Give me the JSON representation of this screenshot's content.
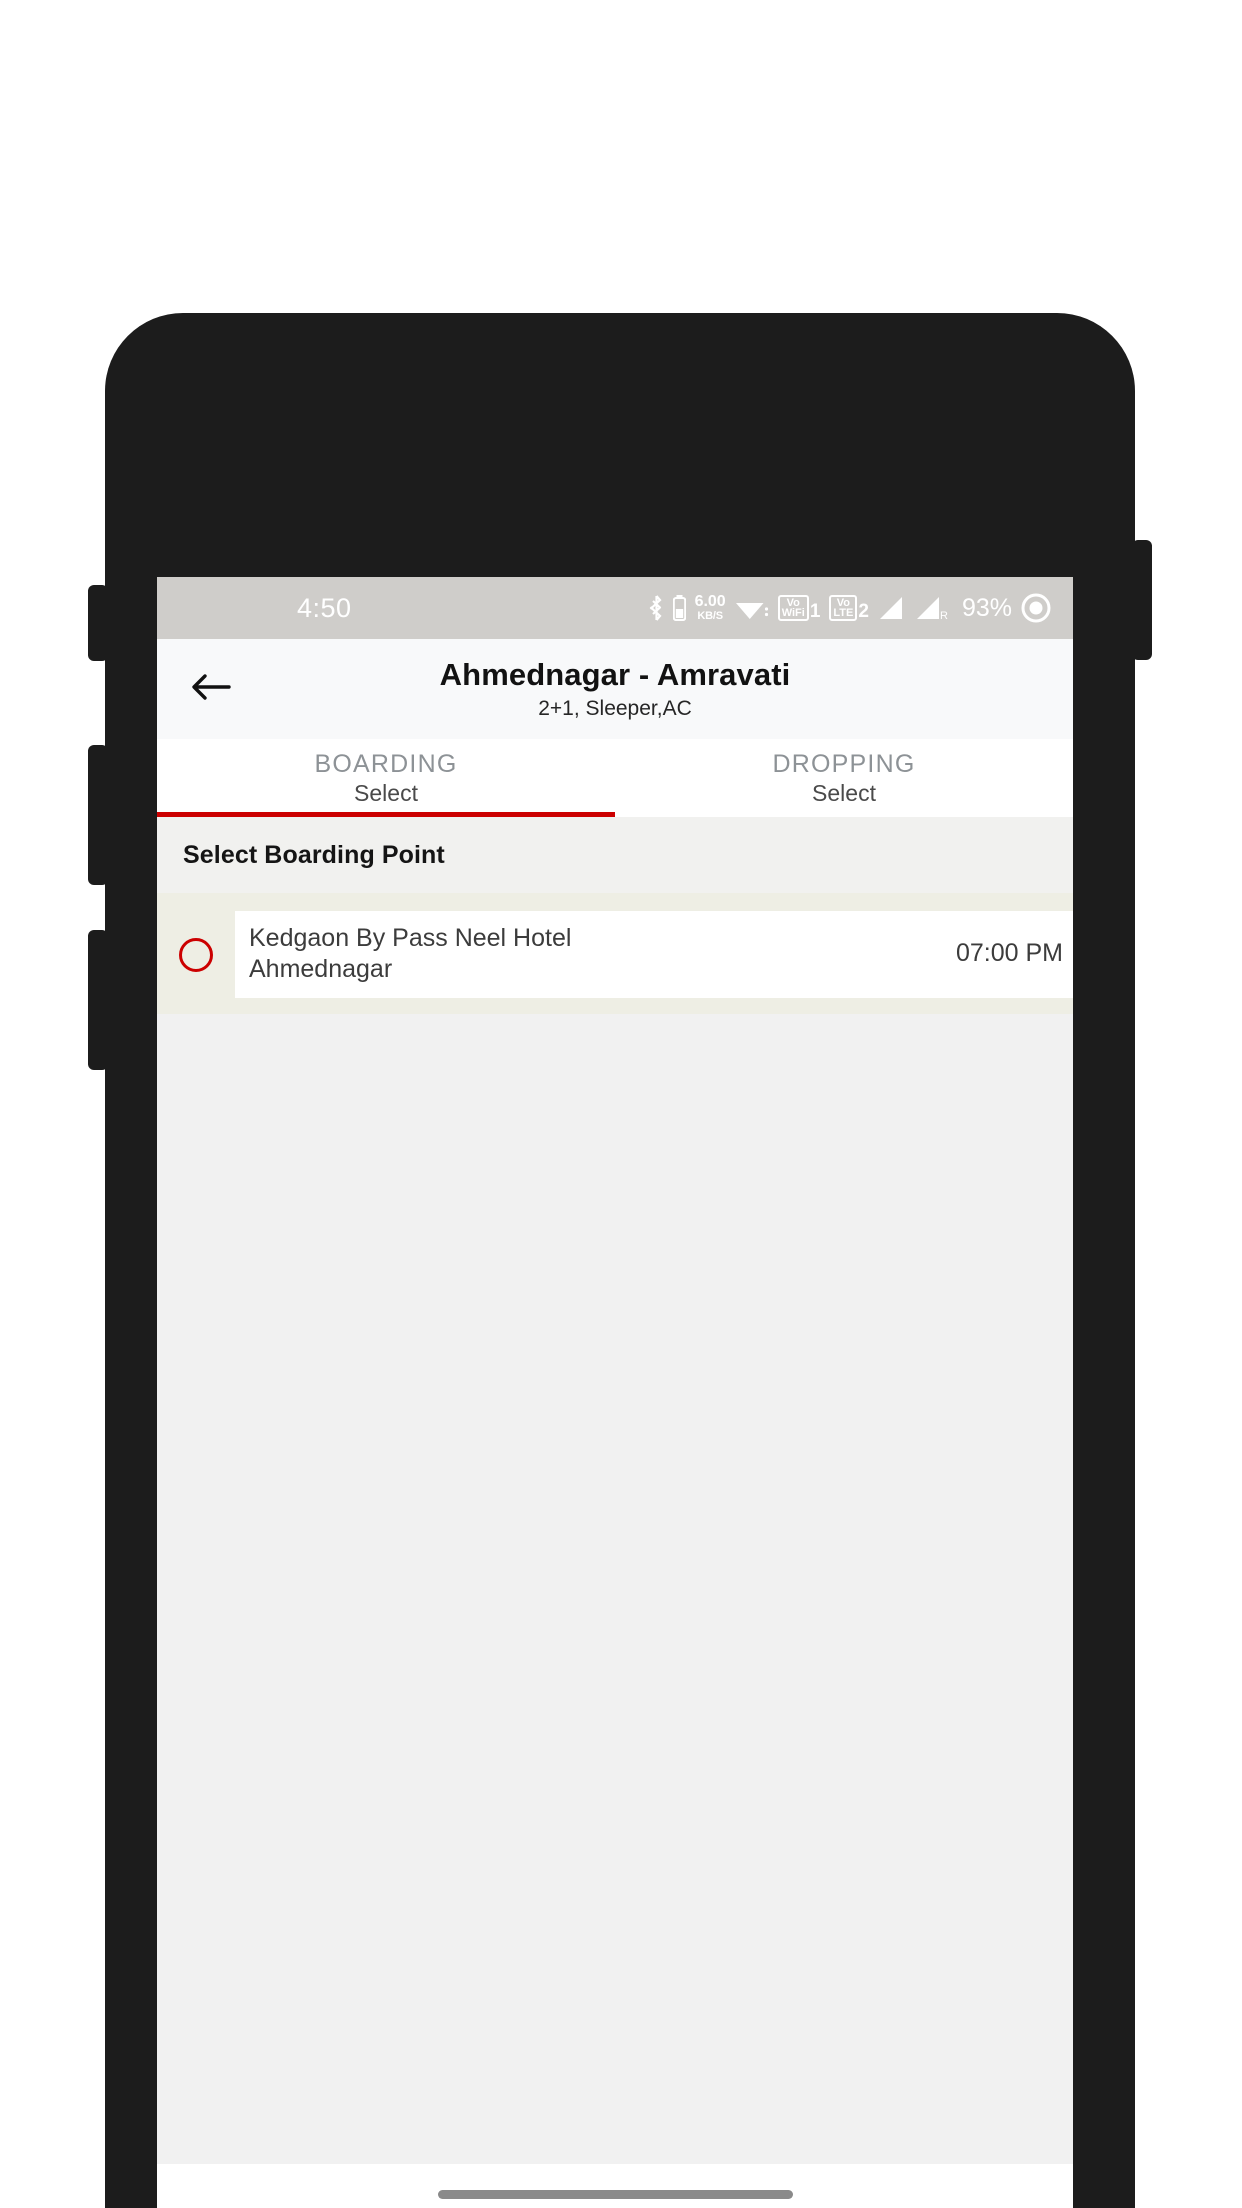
{
  "status_bar": {
    "clock": "4:50",
    "data_rate_value": "6.00",
    "data_rate_unit": "KB/S",
    "vowifi_label_top": "Vo",
    "vowifi_label_bottom": "WiFi",
    "vowifi_sim": "1",
    "volte_label_top": "Vo",
    "volte_label_bottom": "LTE",
    "volte_sim": "2",
    "roaming_marker": "R",
    "battery_percent": "93%",
    "icons": [
      "bluetooth-icon",
      "bluetooth-battery-icon",
      "data-rate-indicator",
      "wifi-icon",
      "vowifi-badge-icon",
      "volte-badge-icon",
      "signal-bars-sim1-icon",
      "signal-bars-sim2-icon",
      "battery-ring-icon"
    ]
  },
  "app_bar": {
    "back_icon": "arrow-left-icon",
    "title": "Ahmednagar - Amravati",
    "subtitle": "2+1, Sleeper,AC"
  },
  "tabs": [
    {
      "label": "BOARDING",
      "value": "Select",
      "active": true
    },
    {
      "label": "DROPPING",
      "value": "Select",
      "active": false
    }
  ],
  "section": {
    "header": "Select Boarding Point"
  },
  "boarding_points": [
    {
      "name": "Kedgaon By Pass Neel Hotel",
      "city": "Ahmednagar",
      "time": "07:00 PM",
      "selected": false
    }
  ],
  "colors": {
    "accent_red": "#cc0000",
    "status_bar_bg": "#cfcdca",
    "app_bar_bg": "#f8f9fa",
    "section_bg": "#f1f1ef",
    "list_bg": "#eeeee4",
    "content_bg": "#f1f1f1"
  },
  "nav_bar": {
    "handle": "home-gesture-pill"
  }
}
